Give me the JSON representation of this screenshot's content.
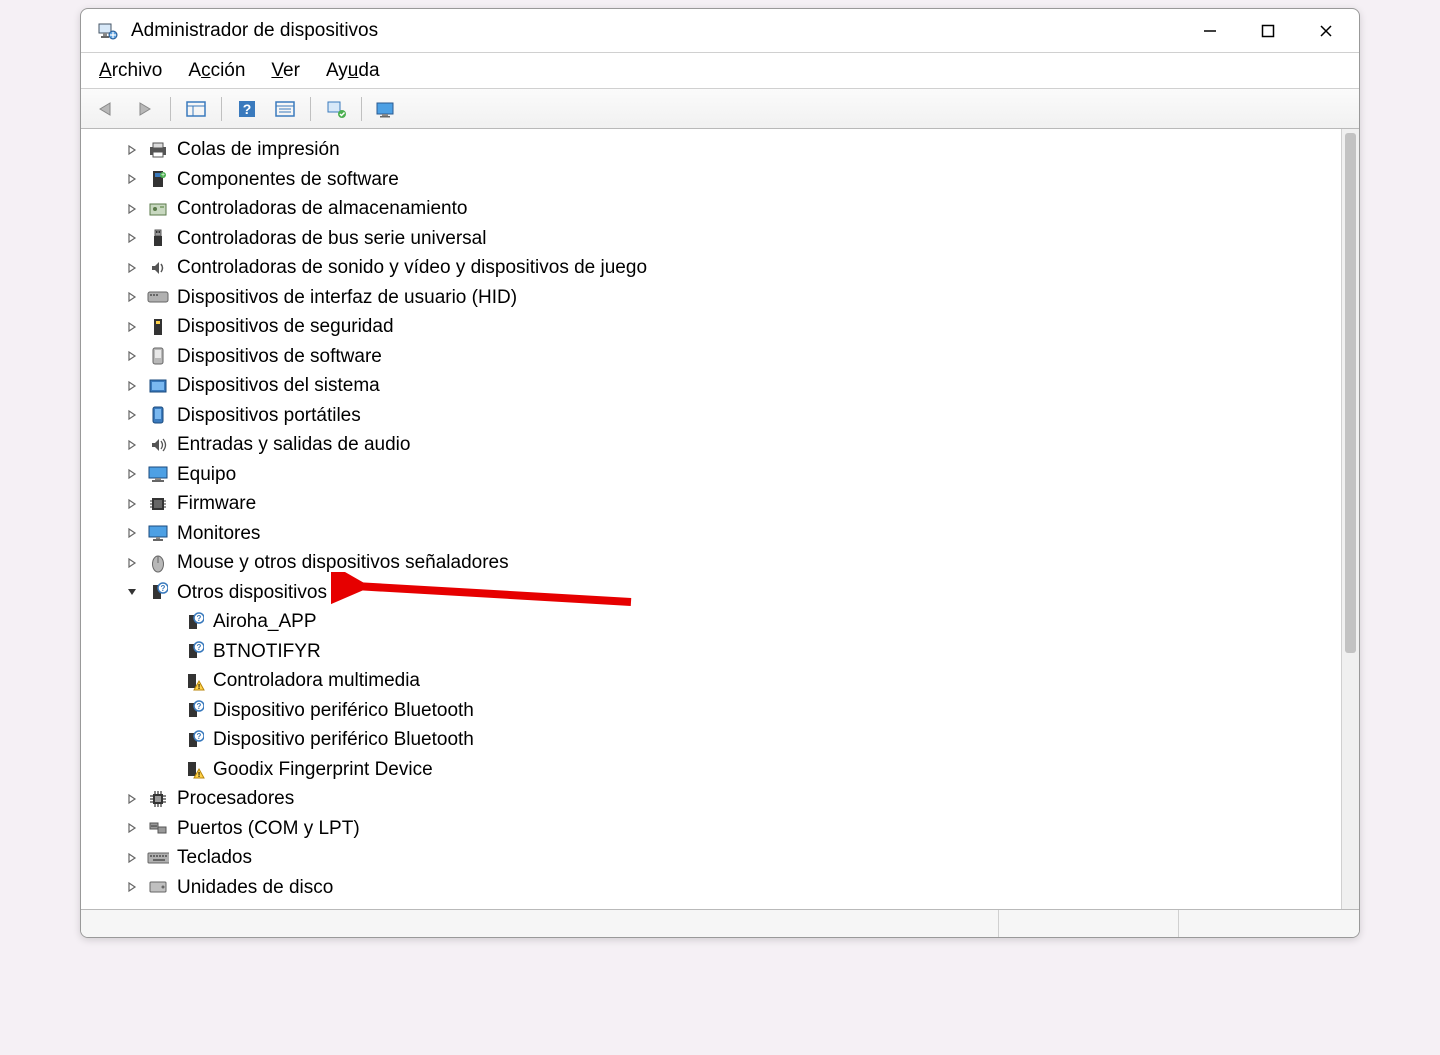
{
  "window": {
    "title": "Administrador de dispositivos"
  },
  "menu": {
    "archivo": "Archivo",
    "accion": "Acción",
    "ver": "Ver",
    "ayuda": "Ayuda"
  },
  "tree": {
    "categories": [
      {
        "label": "Colas de impresión",
        "expanded": false,
        "icon": "printer"
      },
      {
        "label": "Componentes de software",
        "expanded": false,
        "icon": "sw-component"
      },
      {
        "label": "Controladoras de almacenamiento",
        "expanded": false,
        "icon": "storage"
      },
      {
        "label": "Controladoras de bus serie universal",
        "expanded": false,
        "icon": "usb"
      },
      {
        "label": "Controladoras de sonido y vídeo y dispositivos de juego",
        "expanded": false,
        "icon": "sound"
      },
      {
        "label": "Dispositivos de interfaz de usuario (HID)",
        "expanded": false,
        "icon": "hid"
      },
      {
        "label": "Dispositivos de seguridad",
        "expanded": false,
        "icon": "security"
      },
      {
        "label": "Dispositivos de software",
        "expanded": false,
        "icon": "software"
      },
      {
        "label": "Dispositivos del sistema",
        "expanded": false,
        "icon": "system"
      },
      {
        "label": "Dispositivos portátiles",
        "expanded": false,
        "icon": "portable"
      },
      {
        "label": "Entradas y salidas de audio",
        "expanded": false,
        "icon": "audio"
      },
      {
        "label": "Equipo",
        "expanded": false,
        "icon": "computer"
      },
      {
        "label": "Firmware",
        "expanded": false,
        "icon": "firmware"
      },
      {
        "label": "Monitores",
        "expanded": false,
        "icon": "monitor"
      },
      {
        "label": "Mouse y otros dispositivos señaladores",
        "expanded": false,
        "icon": "mouse"
      },
      {
        "label": "Otros dispositivos",
        "expanded": true,
        "icon": "unknown",
        "children": [
          {
            "label": "Airoha_APP",
            "warning": false
          },
          {
            "label": "BTNOTIFYR",
            "warning": false
          },
          {
            "label": "Controladora multimedia",
            "warning": true
          },
          {
            "label": "Dispositivo periférico Bluetooth",
            "warning": false
          },
          {
            "label": "Dispositivo periférico Bluetooth",
            "warning": false
          },
          {
            "label": "Goodix Fingerprint Device",
            "warning": true
          }
        ]
      },
      {
        "label": "Procesadores",
        "expanded": false,
        "icon": "cpu"
      },
      {
        "label": "Puertos (COM y LPT)",
        "expanded": false,
        "icon": "ports"
      },
      {
        "label": "Teclados",
        "expanded": false,
        "icon": "keyboard"
      },
      {
        "label": "Unidades de disco",
        "expanded": false,
        "icon": "disk"
      }
    ]
  },
  "icons": {
    "chevron_right": "›",
    "chevron_down": "⌄"
  }
}
